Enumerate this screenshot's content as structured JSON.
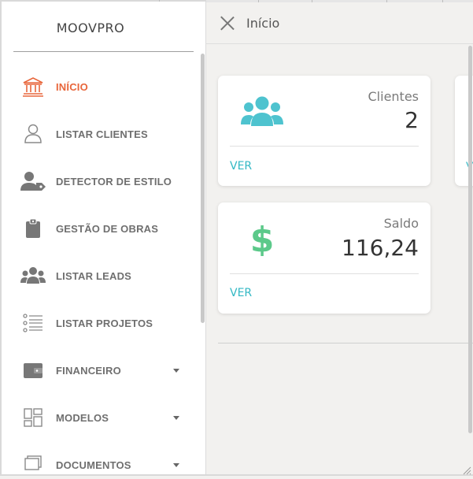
{
  "brand": "MOOVPRO",
  "header": {
    "title": "Início"
  },
  "sidebar": {
    "items": [
      {
        "label": "INÍCIO",
        "icon": "bank-icon",
        "active": true,
        "has_submenu": false
      },
      {
        "label": "LISTAR CLIENTES",
        "icon": "user-icon",
        "active": false,
        "has_submenu": false
      },
      {
        "label": "DETECTOR DE ESTILO",
        "icon": "user-tag-icon",
        "active": false,
        "has_submenu": false
      },
      {
        "label": "GESTÃO DE OBRAS",
        "icon": "clipboard-icon",
        "active": false,
        "has_submenu": false
      },
      {
        "label": "LISTAR LEADS",
        "icon": "users-icon",
        "active": false,
        "has_submenu": false
      },
      {
        "label": "LISTAR PROJETOS",
        "icon": "list-icon",
        "active": false,
        "has_submenu": false
      },
      {
        "label": "FINANCEIRO",
        "icon": "wallet-icon",
        "active": false,
        "has_submenu": true
      },
      {
        "label": "MODELOS",
        "icon": "template-icon",
        "active": false,
        "has_submenu": true
      },
      {
        "label": "DOCUMENTOS",
        "icon": "documents-icon",
        "active": false,
        "has_submenu": true
      }
    ]
  },
  "cards": {
    "clientes": {
      "caption": "Clientes",
      "value": "2",
      "link": "VER",
      "icon": "users-icon",
      "icon_color": "#4ec3cf"
    },
    "saldo": {
      "caption": "Saldo",
      "value": "116,24",
      "link": "VER",
      "icon": "dollar-icon",
      "icon_color": "#5cc98a"
    },
    "peek": {
      "link": "V"
    }
  },
  "colors": {
    "accent": "#e8663b",
    "link": "#33b8c4",
    "label": "#6f6f6f"
  }
}
